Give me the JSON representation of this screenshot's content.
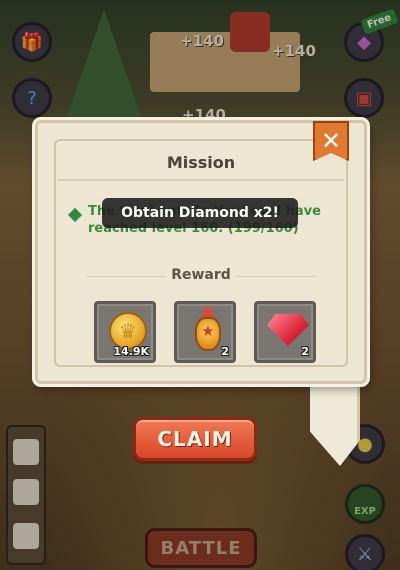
{
  "scene": {
    "labels": [
      "+140",
      "+140",
      "+140"
    ],
    "free_tag": "Free",
    "battle_label": "BATTLE",
    "exp_label": "EXP"
  },
  "dialog": {
    "title": "Mission",
    "mission_text": "The total pets in the Level have reached level 160. (199/160)",
    "reward_label": "Reward",
    "rewards": [
      {
        "item": "coin",
        "count": "14.9K"
      },
      {
        "item": "potion",
        "count": "2"
      },
      {
        "item": "diamond",
        "count": "2"
      }
    ],
    "claim_label": "CLAIM",
    "close_glyph": "✕"
  },
  "toast": {
    "text": "Obtain Diamond x2!"
  },
  "colors": {
    "claim": "#e05a3a",
    "close": "#e07a32",
    "mission_text": "#3f8a3a"
  }
}
